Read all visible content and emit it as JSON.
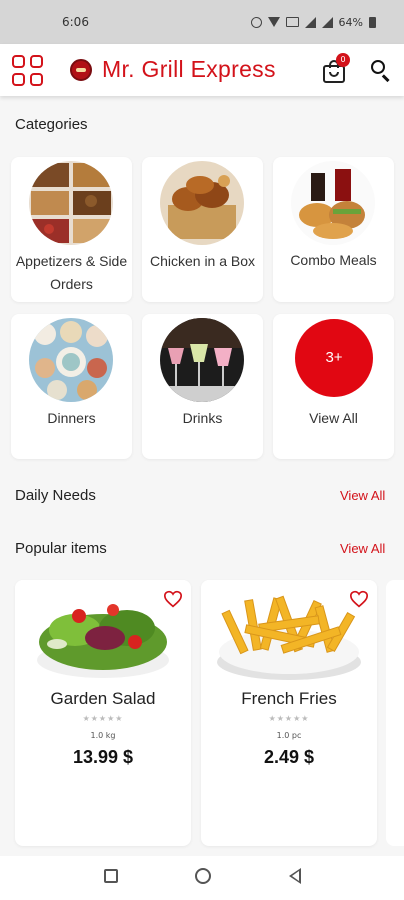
{
  "status_bar": {
    "time": "6:06",
    "battery": "64%"
  },
  "app_bar": {
    "title": "Mr. Grill Express",
    "cart_count": "0",
    "icons": [
      "categories-grid-icon",
      "restaurant-logo",
      "shopping-bag-icon",
      "search-icon"
    ]
  },
  "categories": {
    "title": "Categories",
    "items": [
      {
        "label": "Appetizers & Side Orders"
      },
      {
        "label": "Chicken in a Box"
      },
      {
        "label": "Combo Meals"
      },
      {
        "label": "Dinners"
      },
      {
        "label": "Drinks"
      },
      {
        "label": "View All",
        "badge": "3+"
      }
    ]
  },
  "daily_needs": {
    "title": "Daily Needs",
    "view_all": "View All"
  },
  "popular": {
    "title": "Popular items",
    "view_all": "View All",
    "products": [
      {
        "name": "Garden Salad",
        "rating_stars": "★★★★★",
        "unit": "1.0 kg",
        "price": "13.99 $"
      },
      {
        "name": "French Fries",
        "rating_stars": "★★★★★",
        "unit": "1.0 pc",
        "price": "2.49 $"
      }
    ]
  },
  "colors": {
    "accent": "#d3121a",
    "view_all_circle": "#e10712",
    "background": "#f6f6f6"
  }
}
